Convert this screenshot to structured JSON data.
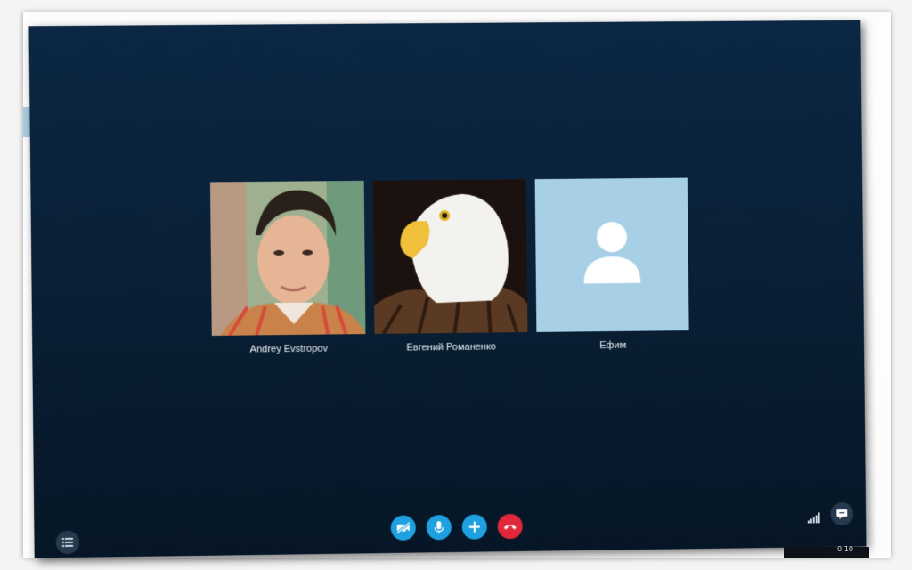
{
  "participants": [
    {
      "name": "Andrey Evstropov",
      "avatar_type": "photo-person"
    },
    {
      "name": "Евгений Романенко",
      "avatar_type": "photo-eagle"
    },
    {
      "name": "Ефим",
      "avatar_type": "default-contact-icon"
    }
  ],
  "controls": {
    "video_icon": "video-off-icon",
    "mic_icon": "microphone-icon",
    "add_icon": "plus-icon",
    "hangup_icon": "end-call-icon"
  },
  "status": {
    "clock": "0:10"
  },
  "colors": {
    "window_bg_top": "#0b2744",
    "window_bg_bottom": "#061626",
    "accent_blue": "#1fa0e0",
    "hangup_red": "#e0283a",
    "default_avatar_bg": "#a7d0e6"
  }
}
